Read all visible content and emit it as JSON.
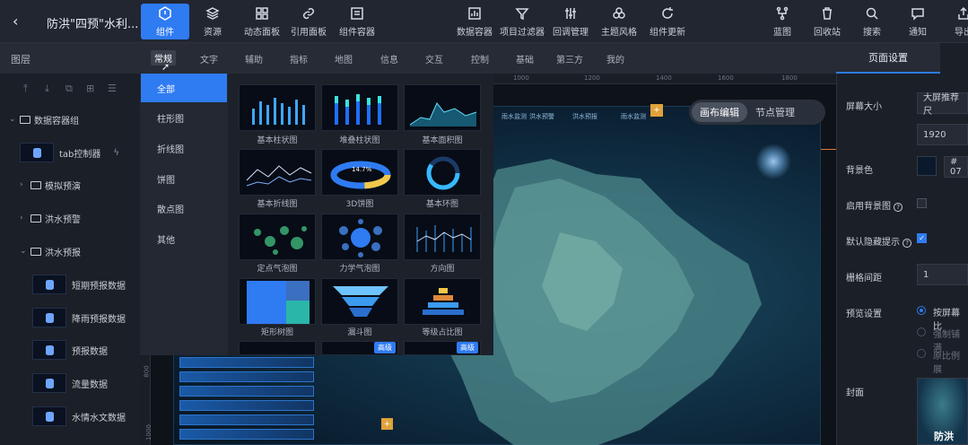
{
  "header": {
    "back_icon": "chevron-left-icon",
    "title": "防洪\"四预\"水利...",
    "left_tools": [
      {
        "label": "组件",
        "icon": "component-icon",
        "active": true
      },
      {
        "label": "资源",
        "icon": "layers-icon"
      },
      {
        "label": "动态面板",
        "icon": "dashboard-icon"
      },
      {
        "label": "引用面板",
        "icon": "link-icon"
      },
      {
        "label": "组件容器",
        "icon": "container-icon"
      }
    ],
    "center_tools": [
      {
        "label": "数据容器",
        "icon": "data-container-icon"
      },
      {
        "label": "项目过滤器",
        "icon": "filter-icon"
      },
      {
        "label": "回调管理",
        "icon": "sliders-icon"
      },
      {
        "label": "主题风格",
        "icon": "theme-icon"
      },
      {
        "label": "组件更新",
        "icon": "refresh-icon"
      }
    ],
    "right_tools": [
      {
        "label": "蓝图",
        "icon": "blueprint-icon"
      },
      {
        "label": "回收站",
        "icon": "trash-icon"
      },
      {
        "label": "搜索",
        "icon": "search-icon"
      },
      {
        "label": "通知",
        "icon": "message-icon"
      },
      {
        "label": "导出",
        "icon": "export-icon"
      }
    ]
  },
  "layers": {
    "title": "图层",
    "tree": [
      {
        "label": "数据容器组",
        "type": "folder",
        "expanded": true
      },
      {
        "label": "tab控制器",
        "type": "item"
      },
      {
        "label": "模拟预演",
        "type": "folder",
        "expanded": false
      },
      {
        "label": "洪水预警",
        "type": "folder",
        "expanded": false
      },
      {
        "label": "洪水预报",
        "type": "folder",
        "expanded": true
      },
      {
        "label": "短期预报数据",
        "type": "item"
      },
      {
        "label": "降雨预报数据",
        "type": "item"
      },
      {
        "label": "预报数据",
        "type": "item"
      },
      {
        "label": "流量数据",
        "type": "item"
      },
      {
        "label": "水情水文数据",
        "type": "item"
      }
    ]
  },
  "component_tabs": [
    "常规",
    "文字",
    "辅助",
    "指标",
    "地图",
    "信息",
    "交互",
    "控制",
    "基础",
    "第三方",
    "我的"
  ],
  "active_component_tab": "常规",
  "categories": [
    "全部",
    "柱形图",
    "折线图",
    "饼图",
    "散点图",
    "其他"
  ],
  "active_category": "全部",
  "gallery": [
    {
      "label": "基本柱状图"
    },
    {
      "label": "堆叠柱状图"
    },
    {
      "label": "基本面积图"
    },
    {
      "label": "基本折线图"
    },
    {
      "label": "3D饼图",
      "value": "14.7%"
    },
    {
      "label": "基本环图"
    },
    {
      "label": "定点气泡图"
    },
    {
      "label": "力学气泡图"
    },
    {
      "label": "方向图"
    },
    {
      "label": "矩形树图"
    },
    {
      "label": "漏斗图"
    },
    {
      "label": "等级占比图"
    },
    {
      "label": "",
      "badge": ""
    },
    {
      "label": "",
      "badge": "高级"
    },
    {
      "label": "",
      "badge": "高级"
    }
  ],
  "ruler_top": [
    "1000",
    "1200",
    "1400",
    "1600",
    "1800"
  ],
  "ruler_left": [
    "800",
    "1000"
  ],
  "canvas": {
    "mode_buttons": [
      "画布编辑",
      "节点管理"
    ],
    "active_mode": "画布编辑",
    "map_tabs": [
      "雨水监测",
      "洪水预警",
      "洪水预报"
    ]
  },
  "right_panel": {
    "tab": "页面设置",
    "screen_size_label": "屏幕大小",
    "screen_size_value": "大屏推荐尺",
    "width_value": "1920",
    "bg_color_label": "背景色",
    "bg_color_value": "# 07",
    "bg_color_swatch": "#0a1a2c",
    "enable_bg_image_label": "启用背景图",
    "default_hide_tip_label": "默认隐藏提示",
    "grid_spacing_label": "栅格间距",
    "grid_spacing_value": "1",
    "preview_label": "预览设置",
    "preview_options": [
      "按屏幕比",
      "强制铺满",
      "原比例展"
    ],
    "cover_label": "封面",
    "cover_text": "防洪"
  },
  "colors": {
    "accent": "#2f7bf2",
    "badge": "#2f7bf2",
    "warn": "#e0a23a"
  }
}
